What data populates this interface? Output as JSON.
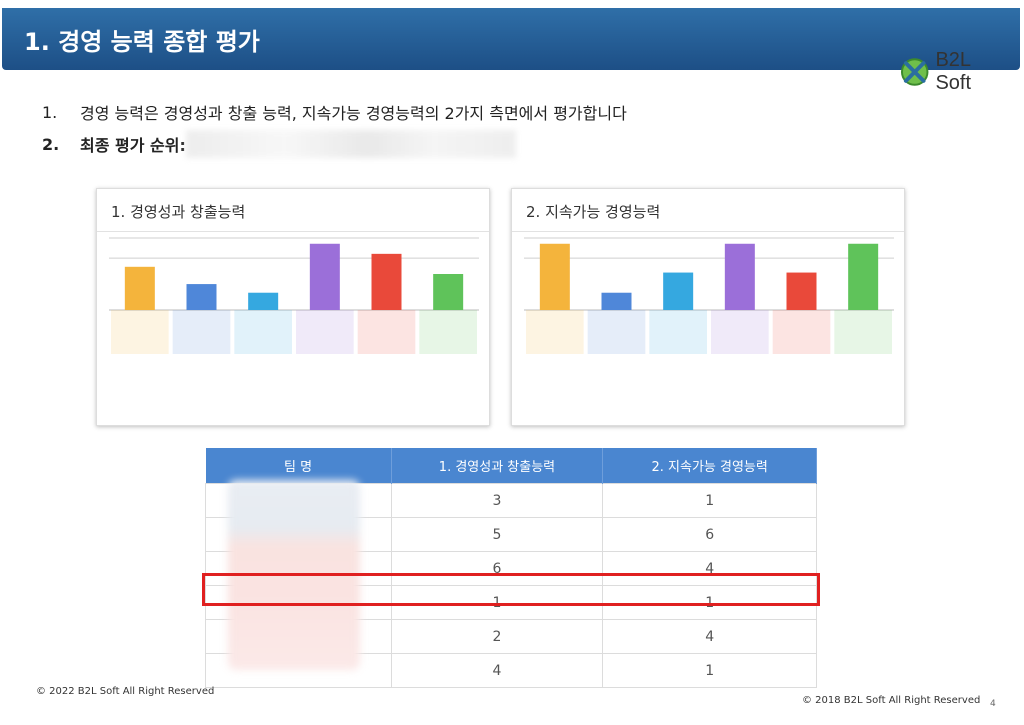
{
  "title": "1. 경영 능력 종합 평가",
  "logo": {
    "text": "B2L Soft"
  },
  "bullets": [
    {
      "num": "1.",
      "text": "경영 능력은 경영성과 창출 능력, 지속가능 경영능력의 2가지 측면에서 평가합니다"
    },
    {
      "num": "2.",
      "text": "최종 평가 순위:"
    }
  ],
  "panels": [
    {
      "title": "1. 경영성과 창출능력"
    },
    {
      "title": "2. 지속가능 경영능력"
    }
  ],
  "chart_data": [
    {
      "type": "bar",
      "title": "1. 경영성과 창출능력",
      "categories": [],
      "values": [
        3,
        1.8,
        1.2,
        4.6,
        3.9,
        2.5
      ],
      "colors": [
        "#f4b43c",
        "#4f87d9",
        "#35a8e0",
        "#9b6fd9",
        "#e9493a",
        "#5fc35a"
      ]
    },
    {
      "type": "bar",
      "title": "2. 지속가능 경영능력",
      "categories": [],
      "values": [
        4.6,
        1.2,
        2.6,
        4.6,
        2.6,
        4.6
      ],
      "colors": [
        "#f4b43c",
        "#4f87d9",
        "#35a8e0",
        "#9b6fd9",
        "#e9493a",
        "#5fc35a"
      ]
    }
  ],
  "table": {
    "headers": [
      "팀 명",
      "1. 경영성과 창출능력",
      "2. 지속가능 경영능력"
    ],
    "rows": [
      [
        "",
        "3",
        "1"
      ],
      [
        "",
        "5",
        "6"
      ],
      [
        "",
        "6",
        "4"
      ],
      [
        "",
        "1",
        "1"
      ],
      [
        "",
        "2",
        "4"
      ],
      [
        "",
        "4",
        "1"
      ]
    ]
  },
  "footer": {
    "left": "© 2022 B2L Soft All Right Reserved",
    "right": "© 2018 B2L Soft All Right Reserved",
    "page": "4"
  }
}
